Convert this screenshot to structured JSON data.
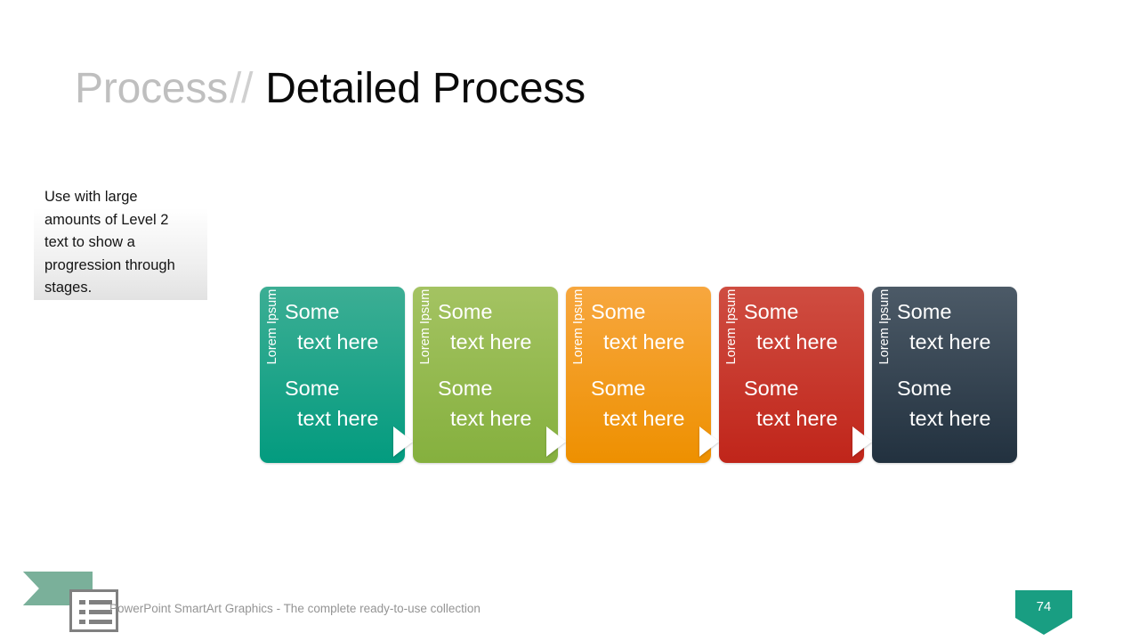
{
  "slide": {
    "title_prefix": "Process",
    "title_separator": "//",
    "title_main": "Detailed Process"
  },
  "note": {
    "text": "Use with large amounts of Level 2 text to show a progression through stages."
  },
  "process": {
    "arrow_icon": "triangle-right-icon",
    "cards": [
      {
        "vertical_label": "Lorem Ipsum",
        "line1_a": "Some",
        "line1_b": "text here",
        "line2_a": "Some",
        "line2_b": "text here",
        "color_top": "#3cae94",
        "color_bottom": "#039b7f",
        "has_arrow": true
      },
      {
        "vertical_label": "Lorem Ipsum",
        "line1_a": "Some",
        "line1_b": "text here",
        "line2_a": "Some",
        "line2_b": "text here",
        "color_top": "#a4c362",
        "color_bottom": "#85b03e",
        "has_arrow": true
      },
      {
        "vertical_label": "Lorem Ipsum",
        "line1_a": "Some",
        "line1_b": "text here",
        "line2_a": "Some",
        "line2_b": "text here",
        "color_top": "#f7a73f",
        "color_bottom": "#ee9000",
        "has_arrow": true
      },
      {
        "vertical_label": "Lorem Ipsum",
        "line1_a": "Some",
        "line1_b": "text here",
        "line2_a": "Some",
        "line2_b": "text here",
        "color_top": "#cf4d41",
        "color_bottom": "#c0251a",
        "has_arrow": true
      },
      {
        "vertical_label": "Lorem Ipsum",
        "line1_a": "Some",
        "line1_b": "text here",
        "line2_a": "Some",
        "line2_b": "text here",
        "color_top": "#4c5a67",
        "color_bottom": "#22313f",
        "has_arrow": false
      }
    ]
  },
  "footer": {
    "caption": "PowerPoint SmartArt Graphics - The complete ready-to-use collection",
    "logo_icon": "list-document-icon",
    "ribbon_icon": "chevron-ribbon-icon",
    "page_number": "74",
    "accent_color": "#199e82",
    "logo_ribbon_color": "#7ab09a"
  }
}
